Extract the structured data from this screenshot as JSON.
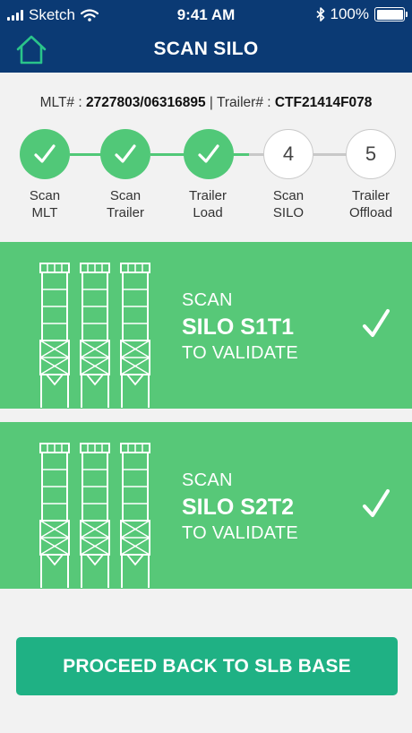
{
  "status_bar": {
    "carrier": "Sketch",
    "time": "9:41 AM",
    "battery": "100%"
  },
  "nav": {
    "title": "SCAN SILO",
    "home_icon": "home-icon"
  },
  "info": {
    "mlt_label": "MLT# :",
    "mlt_value": "2727803/06316895",
    "separator": "|",
    "trailer_label": "Trailer# :",
    "trailer_value": "CTF21414F078"
  },
  "steps": [
    {
      "number": "1",
      "label_line1": "Scan",
      "label_line2": "MLT",
      "status": "done"
    },
    {
      "number": "2",
      "label_line1": "Scan",
      "label_line2": "Trailer",
      "status": "done"
    },
    {
      "number": "3",
      "label_line1": "Trailer",
      "label_line2": "Load",
      "status": "done"
    },
    {
      "number": "4",
      "label_line1": "Scan",
      "label_line2": "SILO",
      "status": "pending"
    },
    {
      "number": "5",
      "label_line1": "Trailer",
      "label_line2": "Offload",
      "status": "pending"
    }
  ],
  "silos": [
    {
      "scan": "SCAN",
      "name": "SILO S1T1",
      "validate": "TO VALIDATE"
    },
    {
      "scan": "SCAN",
      "name": "SILO S2T2",
      "validate": "TO VALIDATE"
    }
  ],
  "proceed_button": "PROCEED BACK TO SLB BASE",
  "colors": {
    "header": "#0b3a74",
    "step_done": "#51c878",
    "card": "#57c878",
    "button": "#1fb184",
    "home_icon": "#2ac48a"
  }
}
